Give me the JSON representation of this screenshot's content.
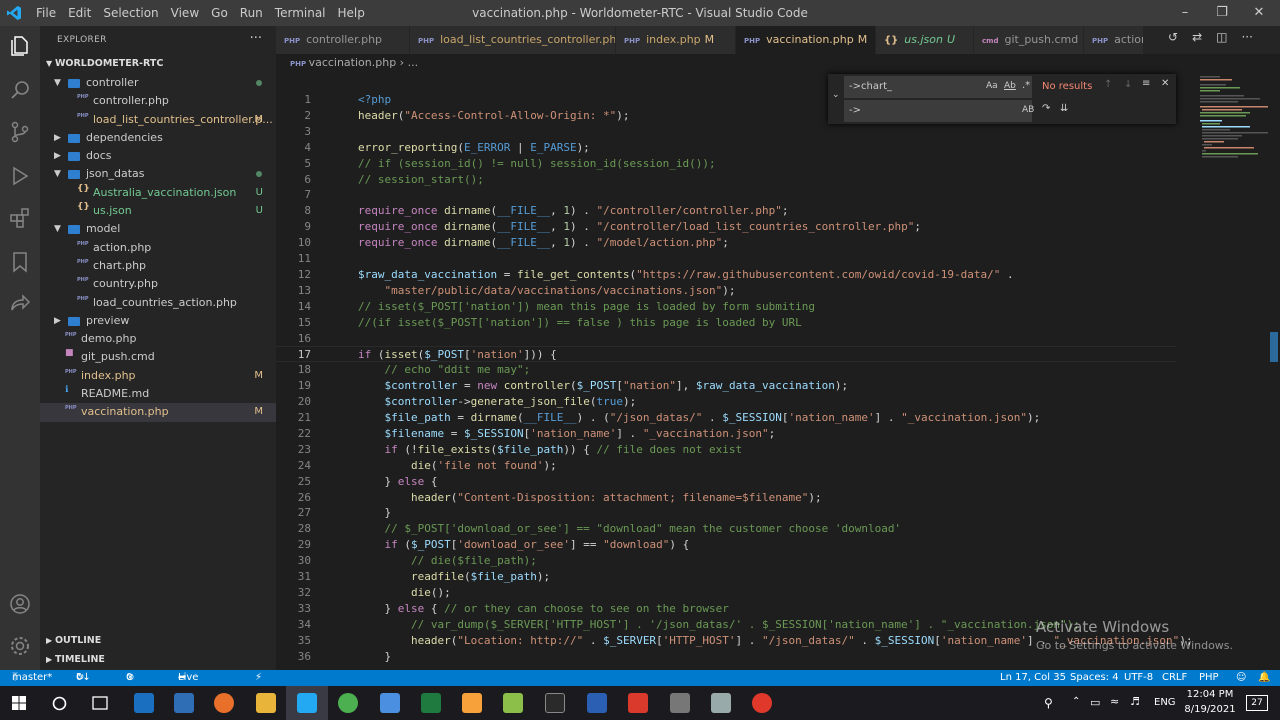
{
  "window": {
    "title": "vaccination.php - Worldometer-RTC - Visual Studio Code"
  },
  "menu": [
    "File",
    "Edit",
    "Selection",
    "View",
    "Go",
    "Run",
    "Terminal",
    "Help"
  ],
  "sidebar": {
    "title": "EXPLORER",
    "workspace": "WORLDOMETER-RTC",
    "outline": "OUTLINE",
    "timeline": "TIMELINE",
    "items": [
      {
        "label": "controller",
        "type": "folder",
        "indent": 1,
        "open": true,
        "dot": true
      },
      {
        "label": "controller.php",
        "type": "php",
        "indent": 2
      },
      {
        "label": "load_list_countries_controller.p...",
        "type": "php",
        "indent": 2,
        "badge": "M"
      },
      {
        "label": "dependencies",
        "type": "folder",
        "indent": 1,
        "open": false
      },
      {
        "label": "docs",
        "type": "folder",
        "indent": 1,
        "open": false
      },
      {
        "label": "json_datas",
        "type": "folder",
        "indent": 1,
        "open": true,
        "dot": true
      },
      {
        "label": "Australia_vaccination.json",
        "type": "json",
        "indent": 2,
        "badge": "U"
      },
      {
        "label": "us.json",
        "type": "json",
        "indent": 2,
        "badge": "U"
      },
      {
        "label": "model",
        "type": "folder",
        "indent": 1,
        "open": true
      },
      {
        "label": "action.php",
        "type": "php",
        "indent": 2
      },
      {
        "label": "chart.php",
        "type": "php",
        "indent": 2
      },
      {
        "label": "country.php",
        "type": "php",
        "indent": 2
      },
      {
        "label": "load_countries_action.php",
        "type": "php",
        "indent": 2
      },
      {
        "label": "preview",
        "type": "folder",
        "indent": 1,
        "open": false
      },
      {
        "label": "demo.php",
        "type": "php",
        "indent": 1
      },
      {
        "label": "git_push.cmd",
        "type": "cmd",
        "indent": 1
      },
      {
        "label": "index.php",
        "type": "php",
        "indent": 1,
        "badge": "M"
      },
      {
        "label": "README.md",
        "type": "md",
        "indent": 1
      },
      {
        "label": "vaccination.php",
        "type": "php",
        "indent": 1,
        "badge": "M",
        "selected": true
      }
    ]
  },
  "tabs": [
    {
      "label": "controller.php",
      "icon": "PHP"
    },
    {
      "label": "load_list_countries_controller.php",
      "icon": "PHP",
      "mod": "M"
    },
    {
      "label": "index.php",
      "icon": "PHP",
      "mod": "M"
    },
    {
      "label": "vaccination.php",
      "icon": "PHP",
      "mod": "M",
      "active": true
    },
    {
      "label": "us.json",
      "icon": "{}",
      "untracked": "U"
    },
    {
      "label": "git_push.cmd",
      "icon": "cmd"
    },
    {
      "label": "action.p",
      "icon": "PHP"
    }
  ],
  "breadcrumb": {
    "file": "vaccination.php",
    "more": "..."
  },
  "find": {
    "search": "->chart_",
    "replace": "->",
    "results": "No results",
    "aa": "Aa",
    "ab": "Ab",
    "ab2": "AB"
  },
  "code": [
    "<?php",
    "header(\"Access-Control-Allow-Origin: *\");",
    "",
    "error_reporting(E_ERROR | E_PARSE);",
    "// if (session_id() != null) session_id(session_id());",
    "// session_start();",
    "",
    "require_once dirname(__FILE__, 1) . \"/controller/controller.php\";",
    "require_once dirname(__FILE__, 1) . \"/controller/load_list_countries_controller.php\";",
    "require_once dirname(__FILE__, 1) . \"/model/action.php\";",
    "",
    "$raw_data_vaccination = file_get_contents(\"https://raw.githubusercontent.com/owid/covid-19-data/\" .",
    "    \"master/public/data/vaccinations/vaccinations.json\");",
    "// isset($_POST['nation']) mean this page is loaded by form submiting",
    "//(if isset($_POST['nation']) == false ) this page is loaded by URL",
    "",
    "if (isset($_POST['nation'])) {",
    "    // echo \"ddit me may\";",
    "    $controller = new controller($_POST[\"nation\"], $raw_data_vaccination);",
    "    $controller->generate_json_file(true);",
    "    $file_path = dirname(__FILE__) . (\"/json_datas/\" . $_SESSION['nation_name'] . \"_vaccination.json\");",
    "    $filename = $_SESSION['nation_name'] . \"_vaccination.json\";",
    "    if (!file_exists($file_path)) { // file does not exist",
    "        die('file not found');",
    "    } else {",
    "        header(\"Content-Disposition: attachment; filename=$filename\");",
    "    }",
    "    // $_POST['download_or_see'] == \"download\" mean the customer choose 'download'",
    "    if ($_POST['download_or_see'] == \"download\") {",
    "        // die($file_path);",
    "        readfile($file_path);",
    "        die();",
    "    } else { // or they can choose to see on the browser",
    "        // var_dump($_SERVER['HTTP_HOST'] . '/json_datas/' . $_SESSION['nation_name'] . \"_vaccination.json\");",
    "        header(\"Location: http://\" . $_SERVER['HTTP_HOST'] . \"/json_datas/\" . $_SESSION['nation_name'] . \"_vaccination.json\");",
    "    }"
  ],
  "status": {
    "branch": "master*",
    "sync": "0↓ 51↑",
    "problems": "0 ⚠ 0",
    "liveshare": "Live Share",
    "position": "Ln 17, Col 35",
    "spaces": "Spaces: 4",
    "encoding": "UTF-8",
    "eol": "CRLF",
    "lang": "PHP"
  },
  "watermark": {
    "line1": "Activate Windows",
    "line2": "Go to Settings to activate Windows."
  },
  "taskbar": {
    "time": "12:04 PM",
    "date": "8/19/2021",
    "lang": "ENG",
    "notif": "27"
  },
  "colors": {
    "accent": "#007acc",
    "modified": "#e2c08d",
    "untracked": "#73c991",
    "folder": "#2f7fd1"
  }
}
